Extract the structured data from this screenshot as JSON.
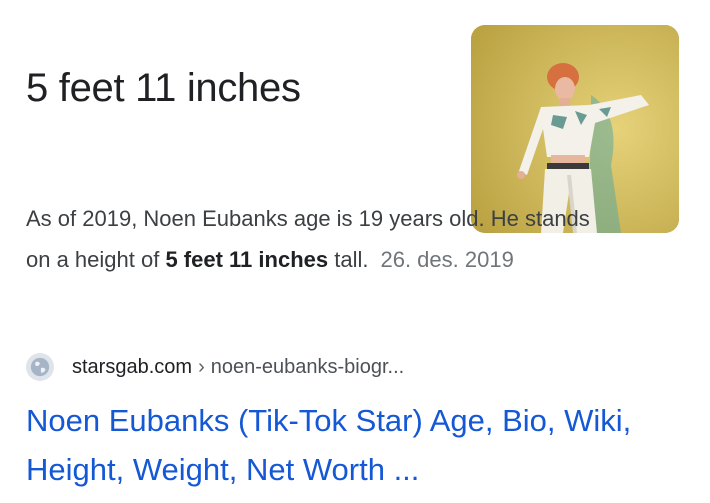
{
  "answer": {
    "title": "5 feet 11 inches"
  },
  "thumbnail": {
    "icon": "person-photo-icon"
  },
  "snippet": {
    "text_before": "As of 2019, Noen Eubanks age is 19 years old. He stands on a height of ",
    "bold": "5 feet 11 inches",
    "text_after": " tall.",
    "date": "26. des. 2019"
  },
  "source": {
    "favicon": "globe-icon",
    "domain": "starsgab.com",
    "separator": "›",
    "path": "noen-eubanks-biogr..."
  },
  "result": {
    "title": "Noen Eubanks (Tik-Tok Star) Age, Bio, Wiki, Height, Weight, Net Worth ..."
  },
  "colors": {
    "link": "#1558d6",
    "text": "#202124",
    "muted": "#70757a"
  }
}
